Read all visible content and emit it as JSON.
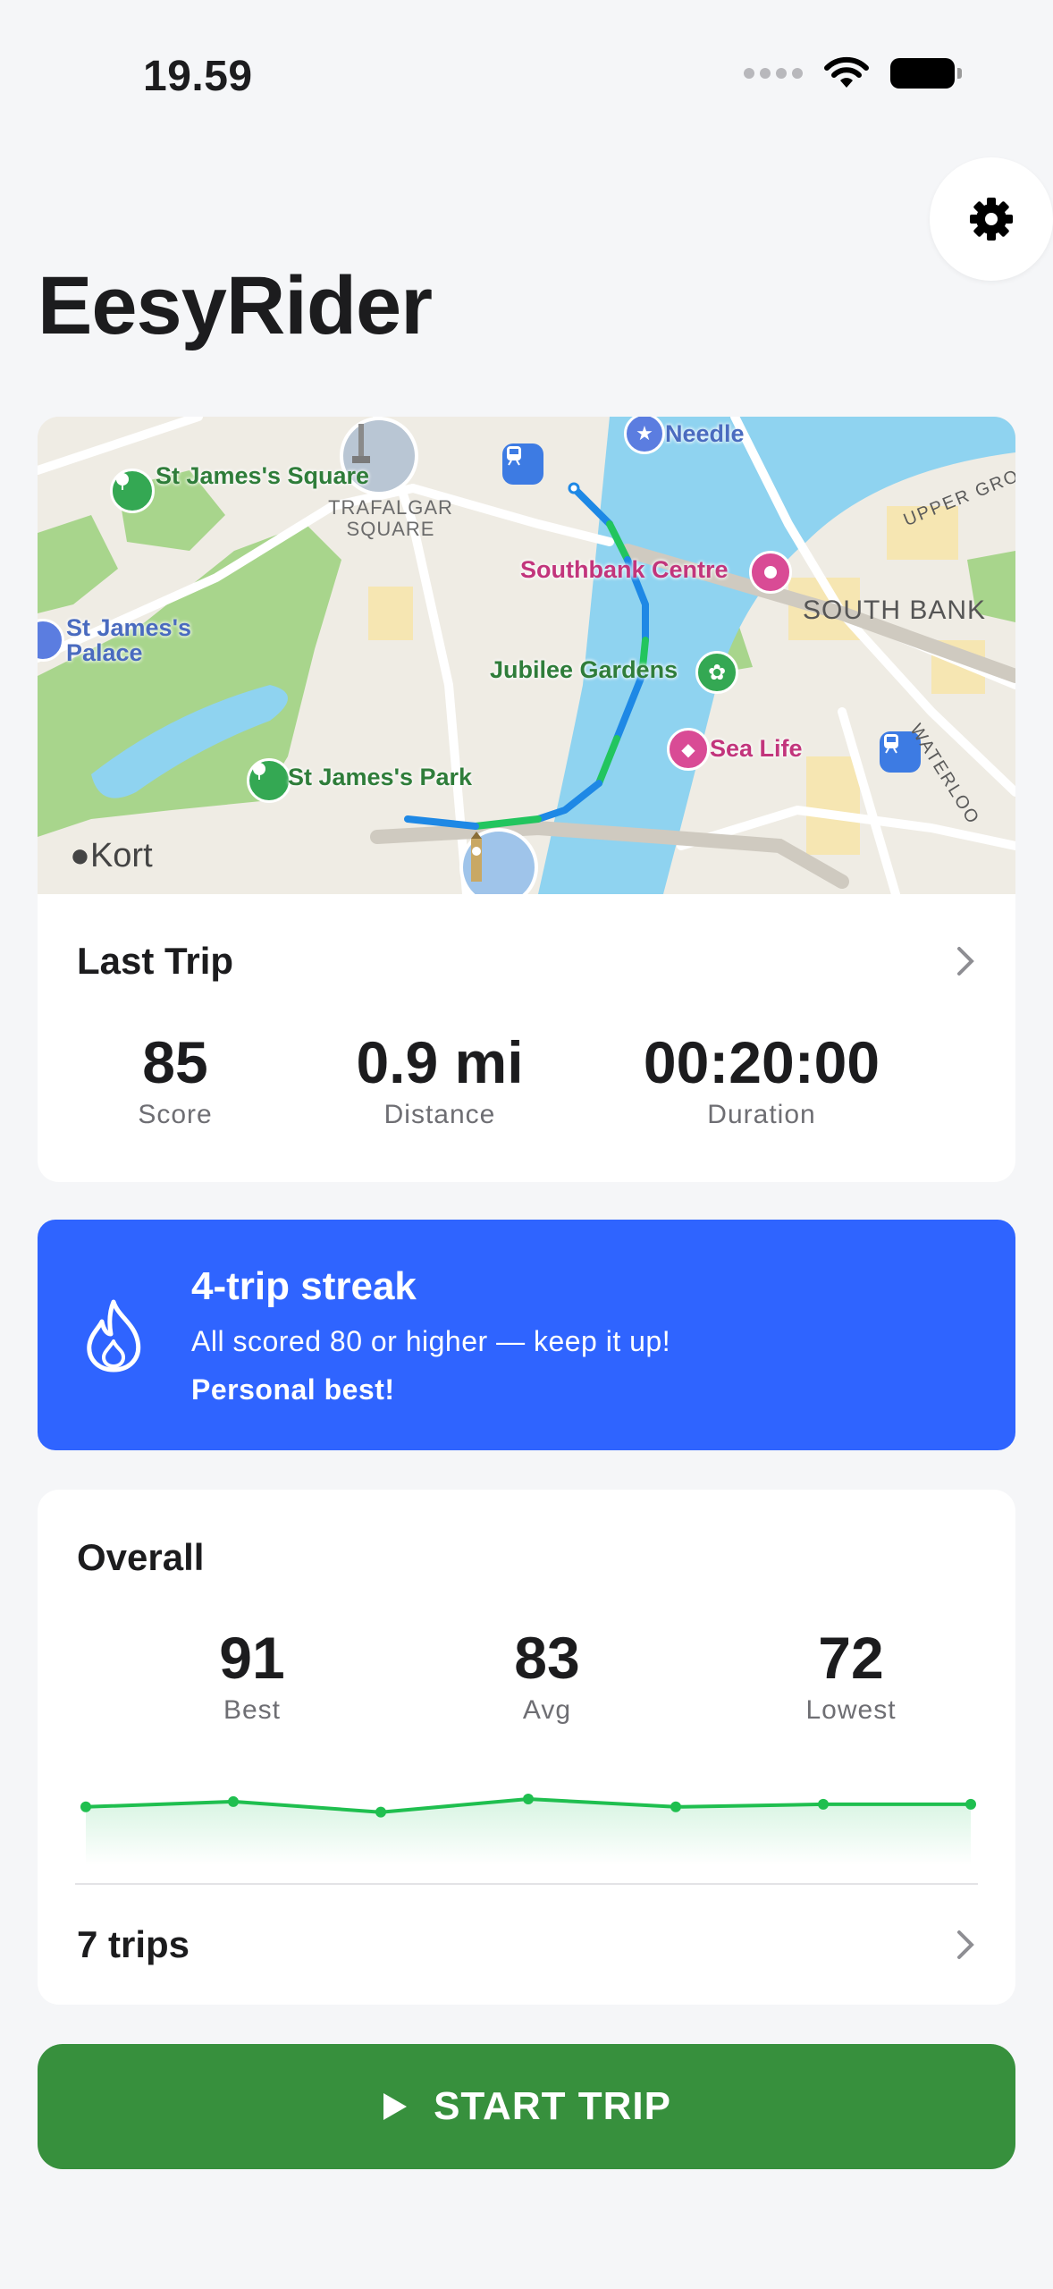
{
  "status_bar": {
    "time": "19.59"
  },
  "app": {
    "title": "EesyRider"
  },
  "map": {
    "attribution": "Kort",
    "labels": {
      "st_james_square": "St James's Square",
      "trafalgar": "TRAFALGAR SQUARE",
      "needle": "Needle",
      "southbank_centre": "Southbank Centre",
      "south_bank": "SOUTH BANK",
      "upper_ground": "UPPER GRO",
      "st_james_palace": "St James's Palace",
      "jubilee": "Jubilee Gardens",
      "sea_life": "Sea Life",
      "waterloo": "WATERLOO",
      "st_james_park": "St James's Park"
    }
  },
  "last_trip": {
    "title": "Last Trip",
    "score": "85",
    "score_label": "Score",
    "distance": "0.9 mi",
    "distance_label": "Distance",
    "duration": "00:20:00",
    "duration_label": "Duration"
  },
  "streak": {
    "title": "4-trip streak",
    "subtitle": "All scored 80 or higher — keep it up!",
    "badge": "Personal best!"
  },
  "overall": {
    "title": "Overall",
    "best": "91",
    "best_label": "Best",
    "avg": "83",
    "avg_label": "Avg",
    "lowest": "72",
    "lowest_label": "Lowest",
    "trips": "7 trips"
  },
  "chart_data": {
    "type": "line",
    "series": [
      {
        "values": [
          82,
          84,
          80,
          85,
          82,
          83,
          83
        ]
      }
    ],
    "color": "#1fbf4f"
  },
  "start_button": {
    "label": "START TRIP"
  },
  "colors": {
    "accent_blue": "#2f64ff",
    "start_green": "#37903d",
    "route_blue": "#1e88e5",
    "route_green": "#22c55e"
  },
  "icons": [
    "gear-icon",
    "chevron-right-icon",
    "flame-icon",
    "play-icon",
    "wifi-icon",
    "battery-icon",
    "apple-icon"
  ]
}
